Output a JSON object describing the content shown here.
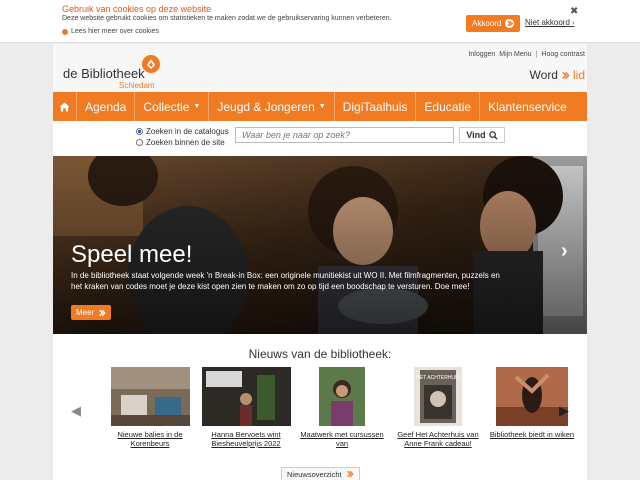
{
  "cookie": {
    "title": "Gebruik van cookies op deze website",
    "description": "Deze website gebruikt cookies om statistieken te maken zodat we de gebruikservaring kunnen verbeteren.",
    "more_link": "Lees hier meer over cookies",
    "agree_label": "Akkoord",
    "disagree_label": "Niet akkoord",
    "close": "✖"
  },
  "header": {
    "links": [
      "Inloggen",
      "Mijn Menu",
      "Hoog contrast"
    ],
    "logo_name": "de Bibliotheek",
    "logo_sub": "Schiedam",
    "word": "Word",
    "lid": "lid"
  },
  "nav": {
    "items": [
      {
        "label": "Agenda",
        "dropdown": false
      },
      {
        "label": "Collectie",
        "dropdown": true
      },
      {
        "label": "Jeugd & Jongeren",
        "dropdown": true
      },
      {
        "label": "DigiTaalhuis",
        "dropdown": false
      },
      {
        "label": "Educatie",
        "dropdown": false
      },
      {
        "label": "Klantenservice",
        "dropdown": false
      }
    ],
    "caret": "▼"
  },
  "search": {
    "option_catalog": "Zoeken in de catalogus",
    "option_site": "Zoeken binnen de site",
    "placeholder": "Waar ben je naar op zoek?",
    "button": "Vind"
  },
  "hero": {
    "headline": "Speel mee!",
    "body": "In de bibliotheek staat volgende week 'n Break-in Box: een originele munitiekist uit WO II. Met filmfragmenten, puzzels en het kraken van codes moet je deze kist open zien te maken om zo op tijd een boodschap te versturen. Doe mee!",
    "more": "Meer"
  },
  "news": {
    "title": "Nieuws van de bibliotheek:",
    "items": [
      {
        "caption": "Nieuwe balies in de Korenbeurs"
      },
      {
        "caption": "Hanna Bervoets wint Biesheuvelprijs 2022"
      },
      {
        "caption": "Maatwerk met cursussen van"
      },
      {
        "caption": "Geef Het Achterhuis van Anne Frank cadeau!",
        "book_title": "HET ACHTERHUIS"
      },
      {
        "caption": "Bibliotheek biedt in wiken"
      }
    ],
    "overview": "Nieuwsoverzicht"
  },
  "colors": {
    "accent": "#f07b22",
    "cookie_title": "#e4561b"
  },
  "icons": [
    "home-icon",
    "search-icon",
    "arrow-right-icon",
    "chevron-left-icon",
    "chevron-right-icon",
    "close-icon",
    "logo-icon"
  ]
}
